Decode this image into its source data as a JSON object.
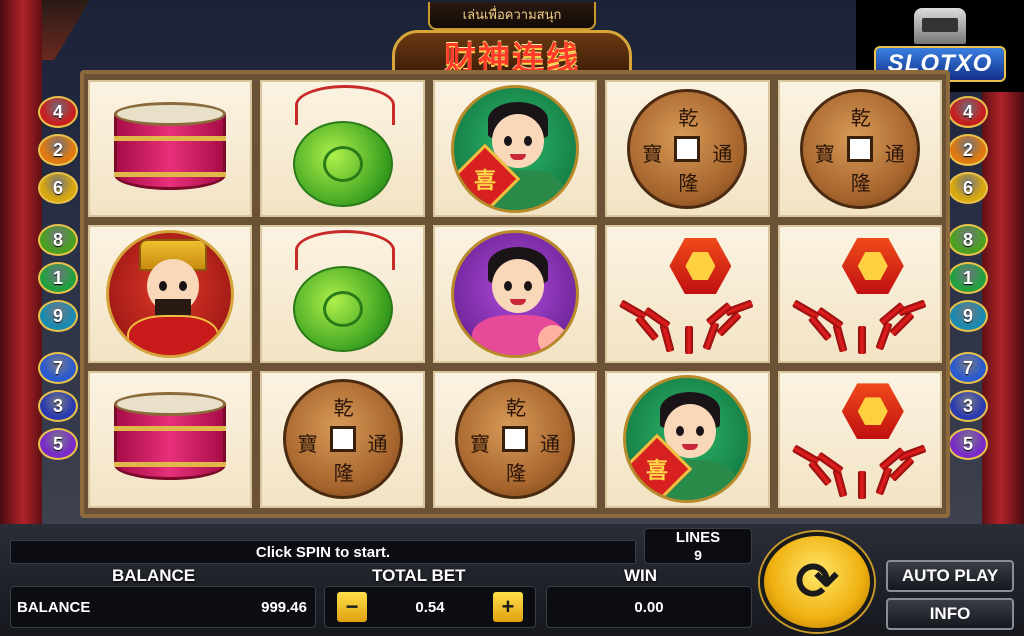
{
  "header": {
    "tab_text": "เล่นเพื่อความสนุก",
    "title": "财神连线",
    "logo": "SLOTXO"
  },
  "reels": [
    [
      "drum",
      "jade-pendant",
      "girl-red-sign",
      "coin",
      "coin"
    ],
    [
      "fortune-god",
      "jade-pendant",
      "girl-peach",
      "firecracker",
      "firecracker"
    ],
    [
      "drum",
      "coin",
      "coin",
      "girl-red-sign",
      "firecracker"
    ]
  ],
  "coin_chars": {
    "top": "乾",
    "left": "寶",
    "right": "通",
    "bottom": "隆"
  },
  "sign_char": "喜",
  "line_markers": {
    "left": [
      "4",
      "2",
      "6",
      "8",
      "1",
      "9",
      "7",
      "3",
      "5"
    ],
    "right": [
      "4",
      "2",
      "6",
      "8",
      "1",
      "9",
      "7",
      "3",
      "5"
    ],
    "colors": [
      "#c82020",
      "#e07a10",
      "#d8a810",
      "#4aa020",
      "#22a040",
      "#1a8ab0",
      "#2a5ad0",
      "#2a3ab0",
      "#7a2ac8"
    ]
  },
  "panel": {
    "status": "Click SPIN to start.",
    "lines_label": "LINES",
    "lines_value": "9",
    "balance_label": "BALANCE",
    "balance_inner_label": "BALANCE",
    "balance_value": "999.46",
    "total_bet_label": "TOTAL BET",
    "total_bet_value": "0.54",
    "minus_label": "−",
    "plus_label": "+",
    "win_label": "WIN",
    "win_value": "0.00",
    "spin_icon": "⟳",
    "auto_play_label": "AUTO PLAY",
    "info_label": "INFO"
  }
}
